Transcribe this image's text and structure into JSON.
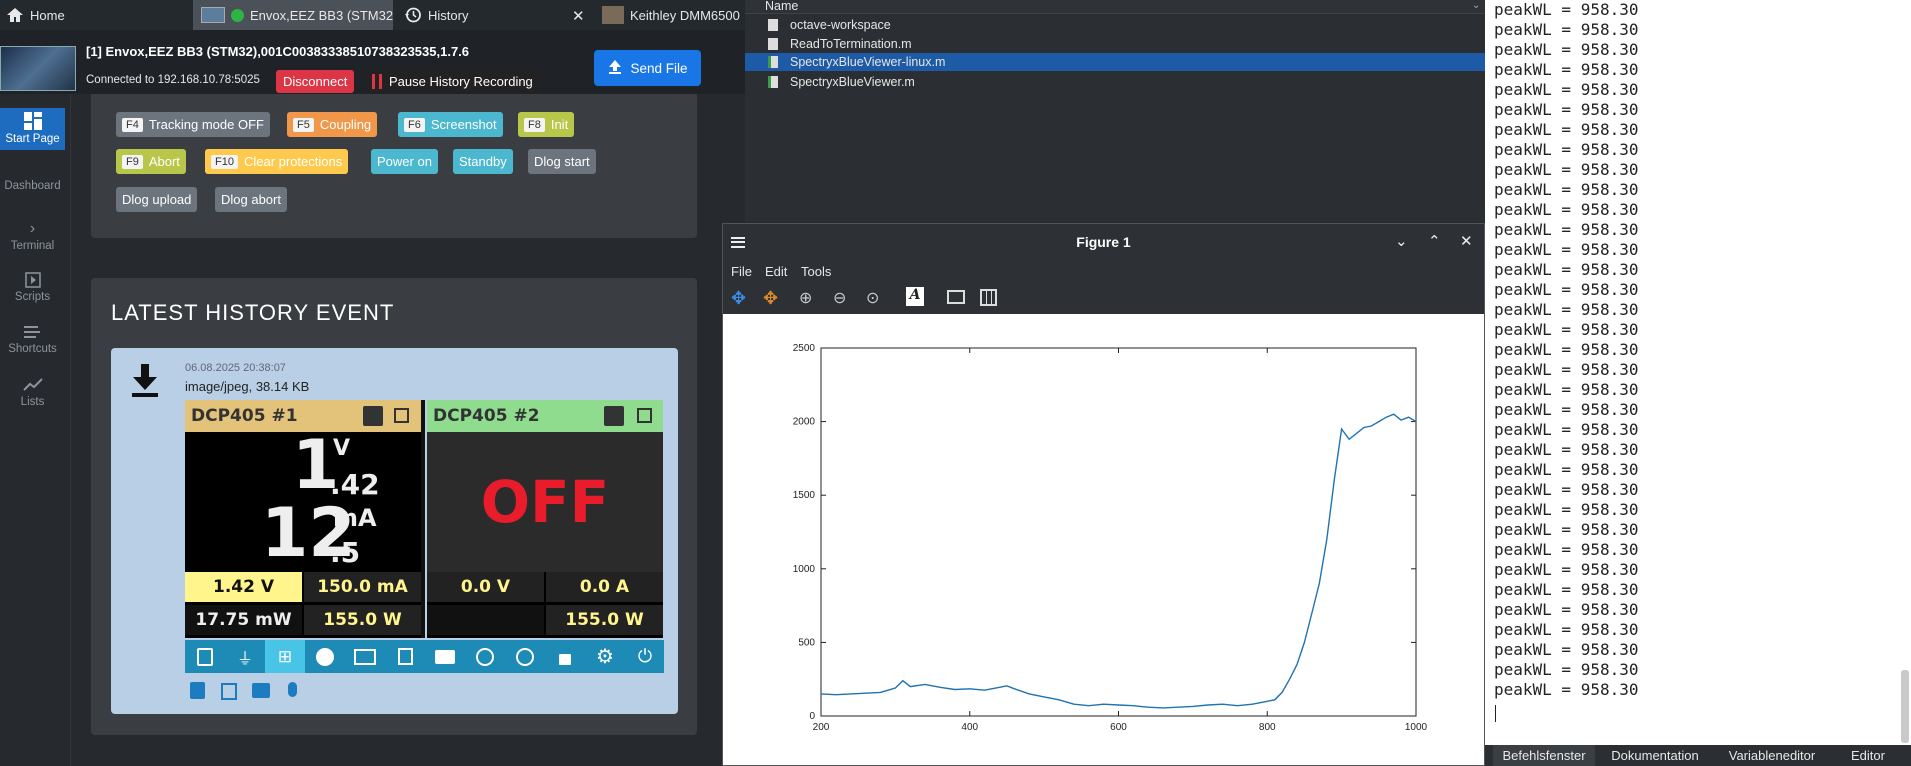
{
  "tabs": [
    {
      "label": "Home"
    },
    {
      "label": "Envox,EEZ BB3 (STM32"
    },
    {
      "label": "History"
    },
    {
      "label": "Keithley DMM6500"
    }
  ],
  "instrument": {
    "title": "[1] Envox,EEZ BB3 (STM32),001C00383338510738323535,1.7.6",
    "connection": "Connected to 192.168.10.78:5025",
    "disconnect_label": "Disconnect",
    "pause_label": "Pause History Recording",
    "send_file_label": "Send File"
  },
  "nav": [
    {
      "label": "Start Page",
      "icon": "grid-icon"
    },
    {
      "label": "Dashboard",
      "icon": "dashboard-icon"
    },
    {
      "label": "Terminal",
      "icon": "chevron-right-icon"
    },
    {
      "label": "Scripts",
      "icon": "play-square-icon"
    },
    {
      "label": "Shortcuts",
      "icon": "list-lines-icon"
    },
    {
      "label": "Lists",
      "icon": "line-chart-icon"
    }
  ],
  "shortcuts": [
    {
      "key": "F4",
      "label": "Tracking mode OFF",
      "color": "#6c757d"
    },
    {
      "key": "F5",
      "label": "Coupling",
      "color": "#f0974a"
    },
    {
      "key": "F6",
      "label": "Screenshot",
      "color": "#4bb8cf"
    },
    {
      "key": "F8",
      "label": "Init",
      "color": "#b8c64a"
    },
    {
      "key": "F9",
      "label": "Abort",
      "color": "#b8c64a"
    },
    {
      "key": "F10",
      "label": "Clear protections",
      "color": "#ffc94d"
    },
    {
      "key": "",
      "label": "Power on",
      "color": "#4bb8cf"
    },
    {
      "key": "",
      "label": "Standby",
      "color": "#4bb8cf"
    },
    {
      "key": "",
      "label": "Dlog start",
      "color": "#6c757d"
    },
    {
      "key": "",
      "label": "Dlog upload",
      "color": "#6c757d"
    },
    {
      "key": "",
      "label": "Dlog abort",
      "color": "#6c757d"
    }
  ],
  "history": {
    "title": "LATEST HISTORY EVENT",
    "date": "06.08.2025 20:38:07",
    "type": "image/jpeg, 38.14 KB",
    "ch1": {
      "name": "DCP405 #1",
      "volt_big": "1",
      "volt_unit": "V",
      "volt_frac": ".42",
      "cur_big": "12",
      "cur_unit": "mA",
      "cur_frac": ".5",
      "set_v": "1.42 V",
      "set_i": "150.0 mA",
      "power": "17.75 mW",
      "pmax": "155.0 W",
      "color": "#e3c27a"
    },
    "ch2": {
      "name": "DCP405 #2",
      "state": "OFF",
      "set_v": "0.0 V",
      "set_i": "0.0 A",
      "pmax": "155.0 W",
      "color": "#8fdc8f"
    }
  },
  "files": {
    "header": "Name",
    "items": [
      {
        "name": "octave-workspace",
        "selected": false
      },
      {
        "name": "ReadToTermination.m",
        "selected": false
      },
      {
        "name": "SpectryxBlueViewer-linux.m",
        "selected": true
      },
      {
        "name": "SpectryxBlueViewer.m",
        "selected": false
      }
    ]
  },
  "figure": {
    "title": "Figure 1",
    "menu": [
      "File",
      "Edit",
      "Tools"
    ]
  },
  "chart_data": {
    "type": "line",
    "title": "",
    "xlabel": "",
    "ylabel": "",
    "xlim": [
      200,
      1000
    ],
    "ylim": [
      0,
      2500
    ],
    "xticks": [
      200,
      400,
      600,
      800,
      1000
    ],
    "yticks": [
      0,
      500,
      1000,
      1500,
      2000,
      2500
    ],
    "grid": false,
    "color": "#2172b0",
    "x": [
      200,
      220,
      240,
      260,
      280,
      300,
      310,
      320,
      340,
      360,
      380,
      400,
      420,
      440,
      450,
      460,
      480,
      500,
      520,
      540,
      560,
      580,
      600,
      620,
      640,
      660,
      680,
      700,
      720,
      740,
      760,
      780,
      800,
      810,
      820,
      830,
      840,
      850,
      860,
      870,
      880,
      890,
      900,
      910,
      920,
      930,
      940,
      950,
      960,
      970,
      980,
      990,
      1000
    ],
    "y": [
      150,
      145,
      150,
      155,
      160,
      190,
      240,
      200,
      215,
      195,
      180,
      185,
      175,
      195,
      205,
      185,
      150,
      130,
      110,
      80,
      70,
      80,
      75,
      70,
      60,
      55,
      60,
      65,
      75,
      80,
      70,
      80,
      100,
      110,
      160,
      250,
      350,
      500,
      700,
      900,
      1200,
      1600,
      1950,
      1880,
      1920,
      1960,
      1970,
      2000,
      2030,
      2050,
      2010,
      2030,
      2000
    ]
  },
  "console": {
    "line": "peakWL = 958.30",
    "line_count": 35,
    "tabs": [
      "Befehlsfenster",
      "Dokumentation",
      "Variableneditor",
      "Editor"
    ]
  }
}
